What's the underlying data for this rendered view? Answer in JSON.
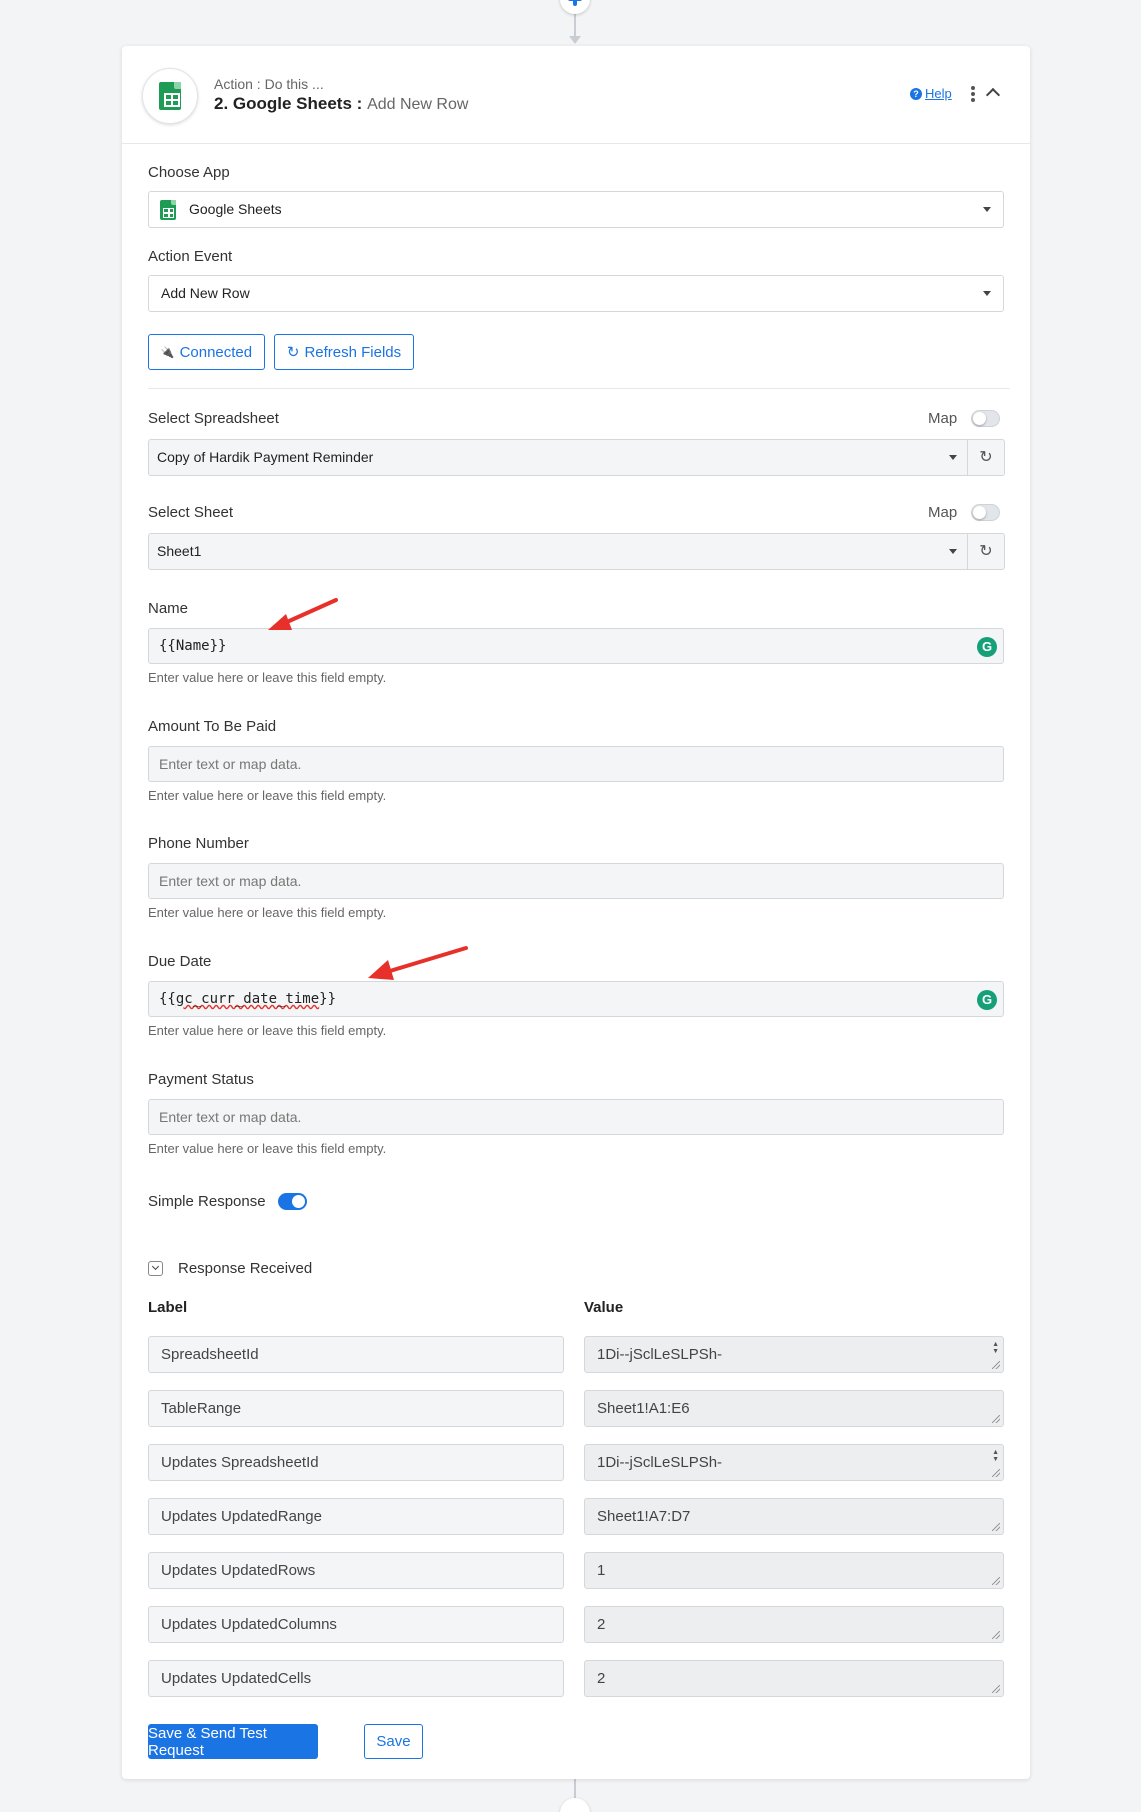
{
  "header": {
    "subtitle": "Action : Do this ...",
    "title": "2. Google Sheets",
    "separator": " :",
    "event": "Add New Row",
    "help_icon": "?",
    "help_label": "Help"
  },
  "choose_app": {
    "label": "Choose App",
    "value": "Google Sheets"
  },
  "action_event": {
    "label": "Action Event",
    "value": "Add New Row"
  },
  "buttons": {
    "connected": "Connected",
    "connected_icon": "🔌",
    "refresh_fields": "Refresh Fields",
    "refresh_icon": "↻"
  },
  "spreadsheet": {
    "label": "Select Spreadsheet",
    "map_label": "Map",
    "value": "Copy of Hardik Payment Reminder"
  },
  "sheet": {
    "label": "Select Sheet",
    "map_label": "Map",
    "value": "Sheet1"
  },
  "refresh_icon_glyph": "↻",
  "grammarly_glyph": "G",
  "fields": {
    "hint": "Enter value here or leave this field empty.",
    "name": {
      "label": "Name",
      "value": "{{Name}}"
    },
    "amount": {
      "label": "Amount To Be Paid",
      "placeholder": "Enter text or map data."
    },
    "phone": {
      "label": "Phone Number",
      "placeholder": "Enter text or map data."
    },
    "due_date": {
      "label": "Due Date",
      "value_prefix": "{{",
      "value_squiggle": "gc_curr_date_time",
      "value_suffix": "}}"
    },
    "payment_status": {
      "label": "Payment Status",
      "placeholder": "Enter text or map data."
    }
  },
  "simple_response": {
    "label": "Simple Response",
    "enabled": true
  },
  "response": {
    "title": "Response Received",
    "col_label": "Label",
    "col_value": "Value",
    "rows": [
      {
        "label": "SpreadsheetId",
        "value": "1Di--jSclLeSLPSh-"
      },
      {
        "label": "TableRange",
        "value": "Sheet1!A1:E6"
      },
      {
        "label": "Updates SpreadsheetId",
        "value": "1Di--jSclLeSLPSh-"
      },
      {
        "label": "Updates UpdatedRange",
        "value": "Sheet1!A7:D7"
      },
      {
        "label": "Updates UpdatedRows",
        "value": "1"
      },
      {
        "label": "Updates UpdatedColumns",
        "value": "2"
      },
      {
        "label": "Updates UpdatedCells",
        "value": "2"
      }
    ]
  },
  "footer": {
    "save_send": "Save & Send Test Request",
    "save": "Save"
  },
  "colors": {
    "accent": "#1b74e4",
    "sheets_green": "#1e9c55",
    "annotation_red": "#e8302a"
  }
}
